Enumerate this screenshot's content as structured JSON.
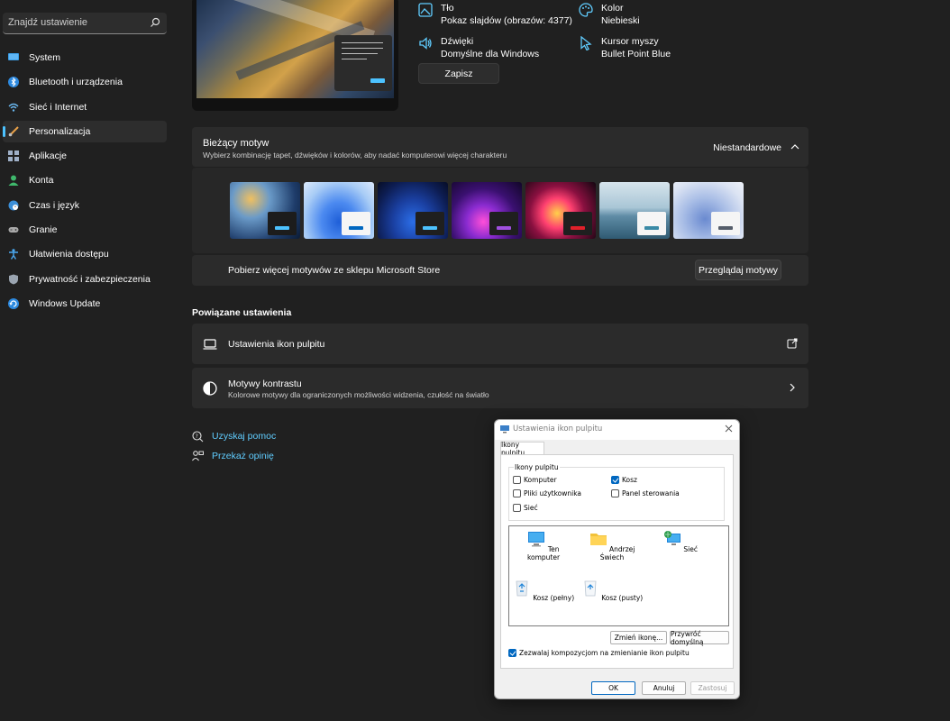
{
  "search": {
    "placeholder": "Znajdź ustawienie"
  },
  "sidebar": {
    "items": [
      {
        "label": "System",
        "icon": "monitor-icon"
      },
      {
        "label": "Bluetooth i urządzenia",
        "icon": "bluetooth-icon"
      },
      {
        "label": "Sieć i Internet",
        "icon": "wifi-icon"
      },
      {
        "label": "Personalizacja",
        "icon": "brush-icon"
      },
      {
        "label": "Aplikacje",
        "icon": "apps-icon"
      },
      {
        "label": "Konta",
        "icon": "person-icon"
      },
      {
        "label": "Czas i język",
        "icon": "globe-clock-icon"
      },
      {
        "label": "Granie",
        "icon": "gamepad-icon"
      },
      {
        "label": "Ułatwienia dostępu",
        "icon": "accessibility-icon"
      },
      {
        "label": "Prywatność i zabezpieczenia",
        "icon": "shield-icon"
      },
      {
        "label": "Windows Update",
        "icon": "update-icon"
      }
    ],
    "selected_index": 3
  },
  "theme_attrs": {
    "background": {
      "title": "Tło",
      "value": "Pokaz slajdów (obrazów: 4377)"
    },
    "color": {
      "title": "Kolor",
      "value": "Niebieski"
    },
    "sounds": {
      "title": "Dźwięki",
      "value": "Domyślne dla Windows"
    },
    "cursor": {
      "title": "Kursor myszy",
      "value": "Bullet Point Blue"
    },
    "save_label": "Zapisz"
  },
  "current_theme": {
    "title": "Bieżący motyw",
    "subtitle": "Wybierz kombinację tapet, dźwięków i kolorów, aby nadać komputerowi więcej charakteru",
    "state": "Niestandardowe"
  },
  "store": {
    "text": "Pobierz więcej motywów ze sklepu Microsoft Store",
    "button": "Przeglądaj motywy"
  },
  "related": {
    "title": "Powiązane ustawienia",
    "desktop_icons": "Ustawienia ikon pulpitu",
    "contrast_title": "Motywy kontrastu",
    "contrast_sub": "Kolorowe motywy dla ograniczonych możliwości widzenia, czułość na światło"
  },
  "links": {
    "help": "Uzyskaj pomoc",
    "feedback": "Przekaż opinię"
  },
  "dialog": {
    "title": "Ustawienia ikon pulpitu",
    "tab": "Ikony pulpitu",
    "group_label": "Ikony pulpitu",
    "checkboxes": {
      "computer": "Komputer",
      "bin": "Kosz",
      "user_files": "Pliki użytkownika",
      "control_panel": "Panel sterowania",
      "network": "Sieć"
    },
    "icons": {
      "this_pc": "Ten komputer",
      "user": "Andrzej Świech",
      "network": "Sieć",
      "bin_full": "Kosz (pełny)",
      "bin_empty": "Kosz (pusty)"
    },
    "change_icon": "Zmień ikonę...",
    "restore_default": "Przywróć domyślną",
    "allow_themes": "Zezwalaj kompozycjom na zmienianie ikon pulpitu",
    "ok": "OK",
    "cancel": "Anuluj",
    "apply": "Zastosuj"
  },
  "colors": {
    "accent": "#4cc2ff",
    "link": "#60cdff",
    "checkbox": "#0067c0"
  }
}
